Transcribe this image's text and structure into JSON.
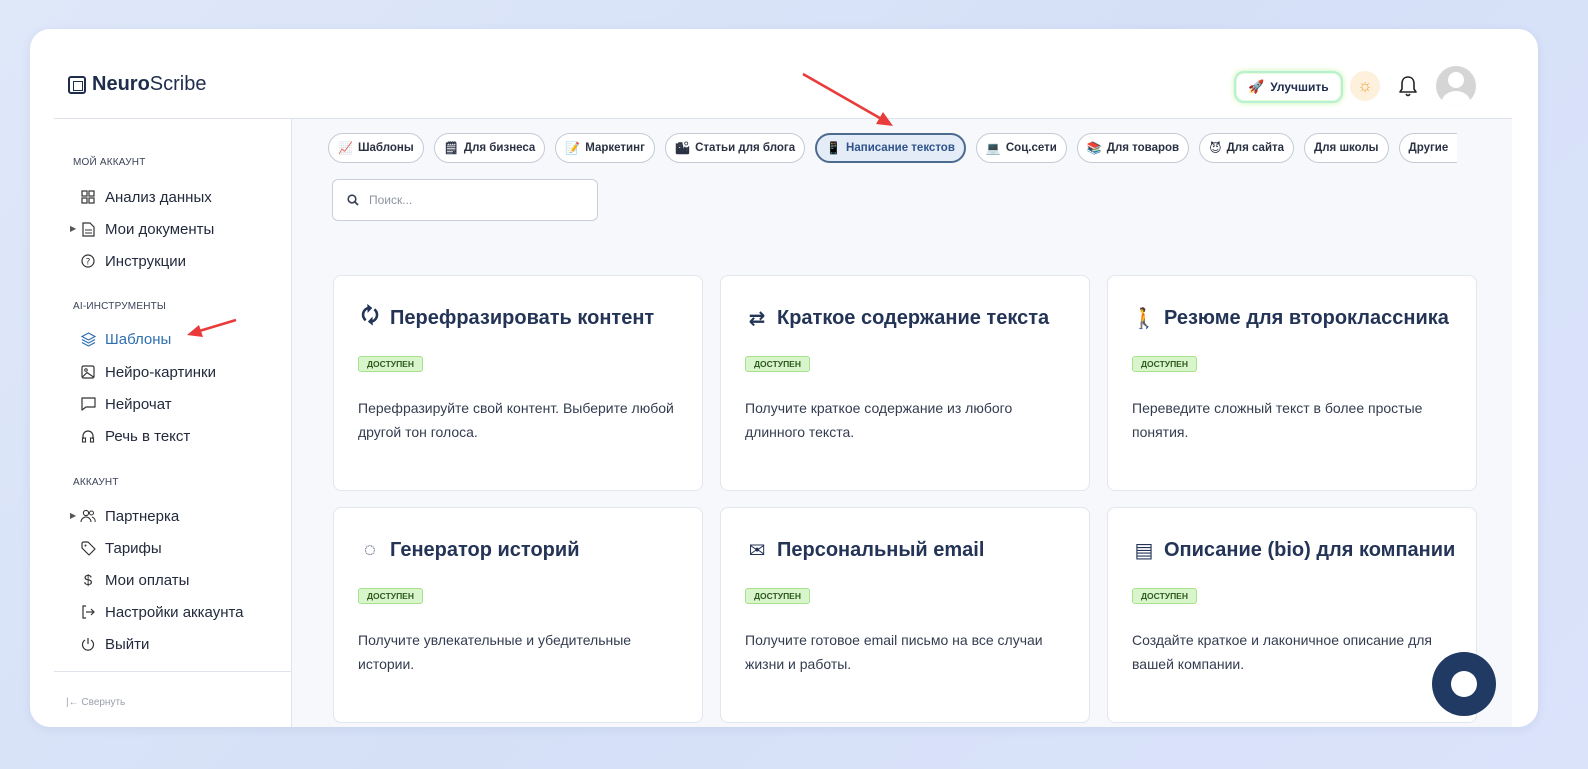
{
  "app": {
    "brand_bold": "Neuro",
    "brand_light": "Scribe"
  },
  "header": {
    "upgrade_label": "Улучшить"
  },
  "sidebar": {
    "sections": [
      {
        "title": "МОЙ АККАУНТ"
      },
      {
        "title": "AI-ИНСТРУМЕНТЫ"
      },
      {
        "title": "АККАУНТ"
      }
    ],
    "items": [
      {
        "label": "Анализ данных"
      },
      {
        "label": "Мои документы"
      },
      {
        "label": "Инструкции"
      },
      {
        "label": "Шаблоны"
      },
      {
        "label": "Нейро-картинки"
      },
      {
        "label": "Нейрочат"
      },
      {
        "label": "Речь в текст"
      },
      {
        "label": "Партнерка"
      },
      {
        "label": "Тарифы"
      },
      {
        "label": "Мои оплаты"
      },
      {
        "label": "Настройки аккаунта"
      },
      {
        "label": "Выйти"
      }
    ],
    "collapse_label": "Свернуть"
  },
  "categories": [
    {
      "emoji": "📈",
      "label": "Шаблоны"
    },
    {
      "emoji": "🗒",
      "label": "Для бизнеса"
    },
    {
      "emoji": "📝",
      "label": "Маркетинг"
    },
    {
      "emoji": "🏙",
      "label": "Статьи для блога"
    },
    {
      "emoji": "📱",
      "label": "Написание текстов"
    },
    {
      "emoji": "💻",
      "label": "Соц.сети"
    },
    {
      "emoji": "📚",
      "label": "Для товаров"
    },
    {
      "emoji": "😈",
      "label": "Для сайта"
    },
    {
      "emoji": "",
      "label": "Для школы"
    },
    {
      "emoji": "",
      "label": "Другие"
    }
  ],
  "active_category": "Написание текстов",
  "search": {
    "placeholder": "Поиск..."
  },
  "cards": [
    {
      "icon": "🗘",
      "title": "Перефразировать контент",
      "badge": "ДОСТУПЕН",
      "desc": "Перефразируйте свой контент. Выберите любой другой тон голоса."
    },
    {
      "icon": "⇄",
      "title": "Краткое содержание текста",
      "badge": "ДОСТУПЕН",
      "desc": "Получите краткое содержание из любого длинного текста."
    },
    {
      "icon": "🚶",
      "title": "Резюме для второклассника",
      "badge": "ДОСТУПЕН",
      "desc": "Переведите сложный текст в более простые понятия."
    },
    {
      "icon": "◌",
      "title": "Генератор историй",
      "badge": "ДОСТУПЕН",
      "desc": "Получите увлекательные и убедительные истории."
    },
    {
      "icon": "✉",
      "title": "Персональный email",
      "badge": "ДОСТУПЕН",
      "desc": "Получите готовое email письмо на все случаи жизни и работы."
    },
    {
      "icon": "▤",
      "title": "Описание (bio) для компании",
      "badge": "ДОСТУПЕН",
      "desc": "Создайте краткое и лаконичное описание для вашей компании."
    }
  ]
}
